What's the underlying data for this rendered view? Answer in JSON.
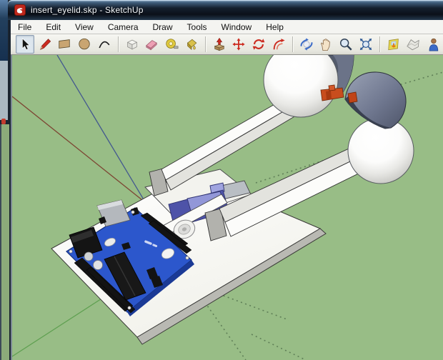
{
  "window": {
    "title": "insert_eyelid.skp - SketchUp",
    "app": "SketchUp"
  },
  "menu_bar": {
    "items": [
      "File",
      "Edit",
      "View",
      "Camera",
      "Draw",
      "Tools",
      "Window",
      "Help"
    ]
  },
  "toolbar": {
    "selected_tool": "Select",
    "tools": [
      "Select",
      "Line",
      "Rectangle",
      "Circle",
      "Arc",
      "Make Component",
      "Eraser",
      "Tape Measure",
      "Paint Bucket",
      "Push/Pull",
      "Move",
      "Rotate",
      "Offset",
      "Orbit",
      "Pan",
      "Zoom",
      "Zoom Extents",
      "Add Location",
      "Toggle Terrain",
      "Photo Textures"
    ]
  },
  "viewport": {
    "scene_parts": [
      "base-plate",
      "arduino-board",
      "servo-motor",
      "servo-horn",
      "mounting-plate",
      "eye-rail-left",
      "eye-rail-right",
      "eyeball-left",
      "eyeball-right",
      "eyelid-left",
      "eyelid-right",
      "eyelid-insert-orange",
      "drawing-axes"
    ],
    "colors": {
      "sky": "#98bd86",
      "axis_blue": "#44598f",
      "axis_red": "#7d4533",
      "axis_green": "#5fa051",
      "axis_dotted": "#5f7f57",
      "plate_white": "#f9f9f5",
      "plate_edge": "#b9b9b3",
      "rail_white": "#fcfcfa",
      "rail_side": "#e3e3de",
      "rail_cap": "#b2b2ad",
      "arduino_blue": "#2c57cc",
      "arduino_edge": "#1b3a96",
      "component_black": "#161616",
      "usb_silver": "#b4b8bd",
      "servo_indigo": "#4e53a8",
      "servo_lavender": "#9297d8",
      "eyelid_light": "#8a92a6",
      "eyelid_dark": "#394050",
      "insert_orange": "#c84d1d"
    }
  }
}
